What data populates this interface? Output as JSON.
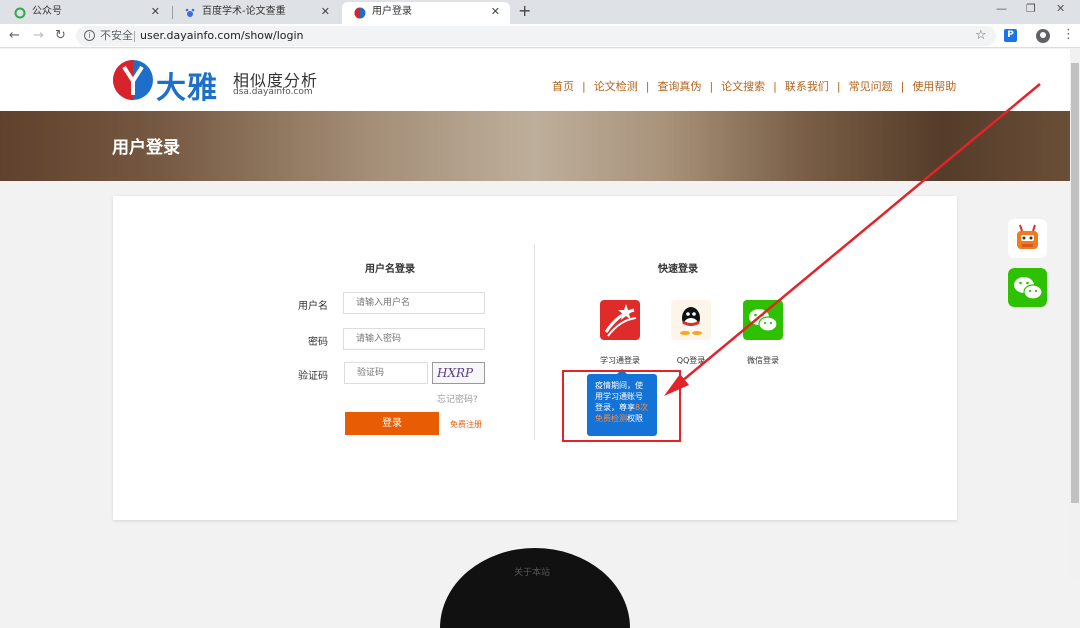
{
  "browser": {
    "tabs": [
      {
        "label": "公众号",
        "active": false
      },
      {
        "label": "百度学术-论文查重",
        "active": false
      },
      {
        "label": "用户登录",
        "active": true
      }
    ],
    "not_secure": "不安全",
    "url": "user.dayainfo.com/show/login",
    "extension_letter": "P"
  },
  "site": {
    "logo_text": "大雅",
    "logo_sub1": "相似度分析",
    "logo_sub2": "dsa.dayainfo.com",
    "nav": [
      "首页",
      "论文检测",
      "查询真伪",
      "论文搜索",
      "联系我们",
      "常见问题",
      "使用帮助"
    ]
  },
  "banner": {
    "title": "用户登录"
  },
  "login": {
    "section_title": "用户名登录",
    "username_label": "用户名",
    "username_placeholder": "请输入用户名",
    "password_label": "密码",
    "password_placeholder": "请输入密码",
    "captcha_label": "验证码",
    "captcha_placeholder": "验证码",
    "captcha_image_text": "HXRP",
    "forgot": "忘记密码?",
    "submit": "登录",
    "register": "免费注册"
  },
  "quick": {
    "section_title": "快速登录",
    "options": [
      {
        "label": "学习通登录",
        "icon": "xuexitong-icon",
        "color": "#e02b2b"
      },
      {
        "label": "QQ登录",
        "icon": "qq-icon",
        "color": "#fdf5ea"
      },
      {
        "label": "微信登录",
        "icon": "wechat-icon",
        "color": "#2dc100"
      }
    ],
    "tooltip_lines": [
      "疫情期间，使",
      "用学习通账号",
      "登录，尊享"
    ],
    "tooltip_highlight": "8次",
    "tooltip_highlight2": "免费检测",
    "tooltip_tail": "权限"
  },
  "footer": {
    "about": "关于本站"
  },
  "colors": {
    "accent": "#e85d04",
    "nav": "#b5651d",
    "brand_blue": "#1d6fc9",
    "annotation_red": "#e2232a"
  }
}
